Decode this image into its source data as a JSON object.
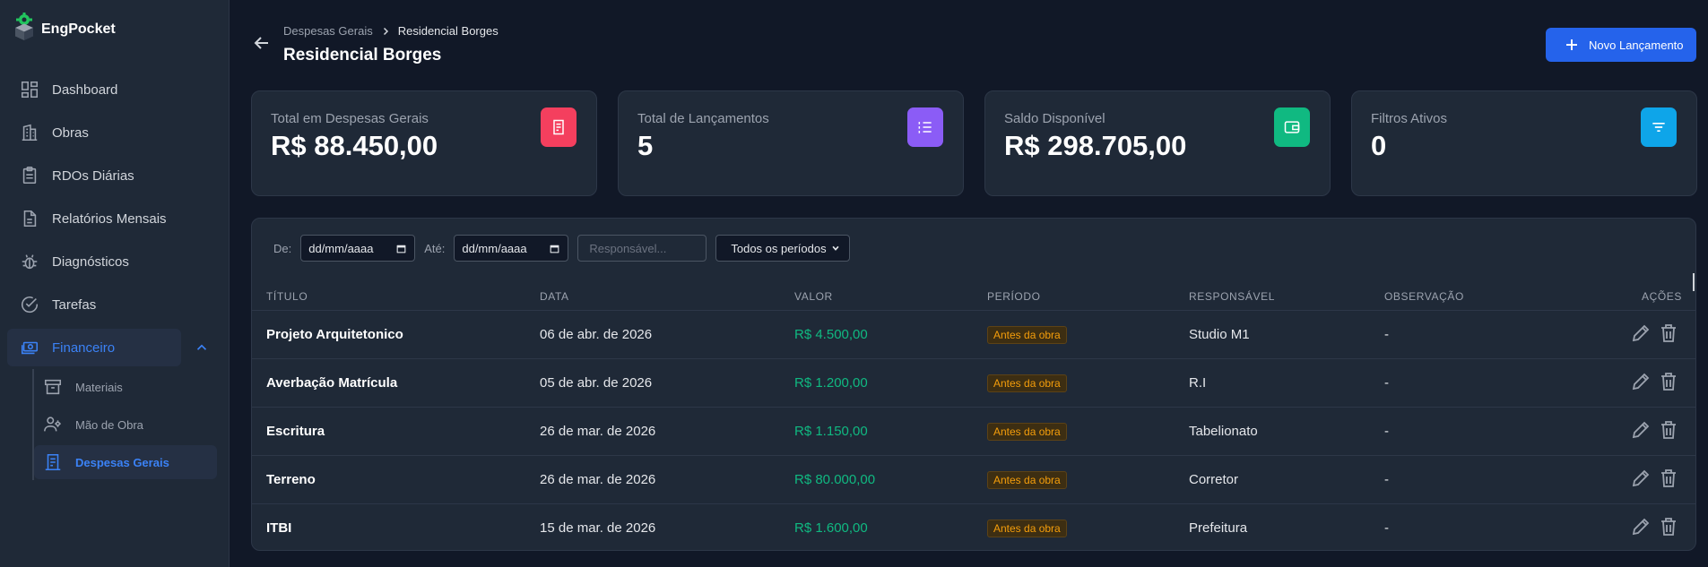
{
  "app": {
    "name": "EngPocket"
  },
  "sidebar": {
    "items": [
      {
        "label": "Dashboard",
        "icon": "dashboard-icon"
      },
      {
        "label": "Obras",
        "icon": "building-icon"
      },
      {
        "label": "RDOs Diárias",
        "icon": "clipboard-icon"
      },
      {
        "label": "Relatórios Mensais",
        "icon": "document-icon"
      },
      {
        "label": "Diagnósticos",
        "icon": "bug-icon"
      },
      {
        "label": "Tarefas",
        "icon": "check-circle-icon"
      },
      {
        "label": "Financeiro",
        "icon": "money-icon",
        "active": true,
        "expanded": true
      }
    ],
    "subitems": [
      {
        "label": "Materiais",
        "icon": "archive-icon"
      },
      {
        "label": "Mão de Obra",
        "icon": "workers-icon"
      },
      {
        "label": "Despesas Gerais",
        "icon": "receipt-icon",
        "active": true
      }
    ]
  },
  "header": {
    "breadcrumb_parent": "Despesas Gerais",
    "breadcrumb_current": "Residencial Borges",
    "title": "Residencial Borges",
    "new_button": "Novo Lançamento"
  },
  "cards": [
    {
      "label": "Total em Despesas Gerais",
      "value": "R$ 88.450,00",
      "icon": "receipt-icon",
      "color": "#f43f5e"
    },
    {
      "label": "Total de Lançamentos",
      "value": "5",
      "icon": "list-icon",
      "color": "#8b5cf6"
    },
    {
      "label": "Saldo Disponível",
      "value": "R$ 298.705,00",
      "icon": "wallet-icon",
      "color": "#10b981"
    },
    {
      "label": "Filtros Ativos",
      "value": "0",
      "icon": "filter-icon",
      "color": "#0ea5e9"
    }
  ],
  "filters": {
    "from_label": "De:",
    "from_value": "dd/mm/aaaa",
    "to_label": "Até:",
    "to_value": "dd/mm/aaaa",
    "responsavel_placeholder": "Responsável...",
    "period_selected": "Todos os períodos"
  },
  "table": {
    "columns": [
      "TÍTULO",
      "DATA",
      "VALOR",
      "PERÍODO",
      "RESPONSÁVEL",
      "OBSERVAÇÃO",
      "AÇÕES"
    ],
    "rows": [
      {
        "titulo": "Projeto Arquitetonico",
        "data": "06 de abr. de 2026",
        "valor": "R$ 4.500,00",
        "periodo": "Antes da obra",
        "responsavel": "Studio M1",
        "observacao": "-"
      },
      {
        "titulo": "Averbação Matrícula",
        "data": "05 de abr. de 2026",
        "valor": "R$ 1.200,00",
        "periodo": "Antes da obra",
        "responsavel": "R.I",
        "observacao": "-"
      },
      {
        "titulo": "Escritura",
        "data": "26 de mar. de 2026",
        "valor": "R$ 1.150,00",
        "periodo": "Antes da obra",
        "responsavel": "Tabelionato",
        "observacao": "-"
      },
      {
        "titulo": "Terreno",
        "data": "26 de mar. de 2026",
        "valor": "R$ 80.000,00",
        "periodo": "Antes da obra",
        "responsavel": "Corretor",
        "observacao": "-"
      },
      {
        "titulo": "ITBI",
        "data": "15 de mar. de 2026",
        "valor": "R$ 1.600,00",
        "periodo": "Antes da obra",
        "responsavel": "Prefeitura",
        "observacao": "-"
      }
    ]
  }
}
